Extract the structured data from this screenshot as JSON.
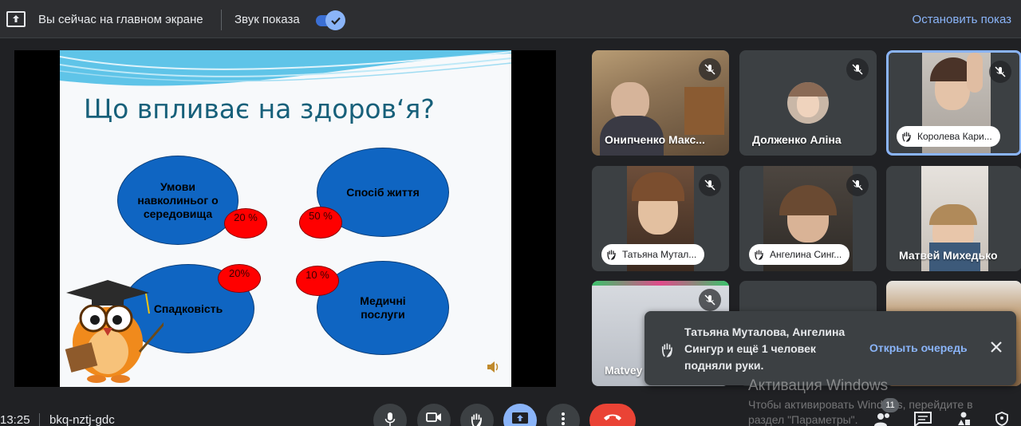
{
  "topbar": {
    "status": "Вы сейчас на главном экране",
    "sound_label": "Звук показа",
    "sound_enabled": true,
    "stop_label": "Остановить показ"
  },
  "slide": {
    "title": "Що впливає на здоров‘я?",
    "factors": [
      {
        "label": "Умови навколиньог о середовища",
        "percent": "20 %"
      },
      {
        "label": "Спосіб життя",
        "percent": "50 %"
      },
      {
        "label": "Спадковість",
        "percent": "20%"
      },
      {
        "label": "Медичні послуги",
        "percent": "10 %"
      }
    ]
  },
  "participants": [
    {
      "name": "Онипченко Макс...",
      "muted": true
    },
    {
      "name": "Долженко Аліна",
      "muted": true
    },
    {
      "name": "Королева Кари...",
      "muted": true,
      "hand_raised": true,
      "active": true
    },
    {
      "name": "Татьяна Мутал...",
      "muted": true,
      "hand_raised": true
    },
    {
      "name": "Ангелина Синг...",
      "muted": true,
      "hand_raised": true
    },
    {
      "name": "Матвей Михедько",
      "muted": false
    },
    {
      "name": "Matvey",
      "muted": true
    }
  ],
  "notification": {
    "message": "Татьяна Муталова, Ангелина Сингур и ещё 1 человек подняли руки.",
    "action": "Открыть очередь"
  },
  "watermark": {
    "title": "Активация Windows",
    "text": "Чтобы активировать Windows, перейдите в раздел \"Параметры\"."
  },
  "bottombar": {
    "time": "13:25",
    "meeting_code": "bkq-nztj-gdc",
    "people_count": "11"
  },
  "colors": {
    "accent": "#8ab4f8",
    "background": "#202124",
    "end_call": "#ea4335",
    "slide_ellipse": "#0f65c2",
    "slide_badge": "#ff0000"
  }
}
